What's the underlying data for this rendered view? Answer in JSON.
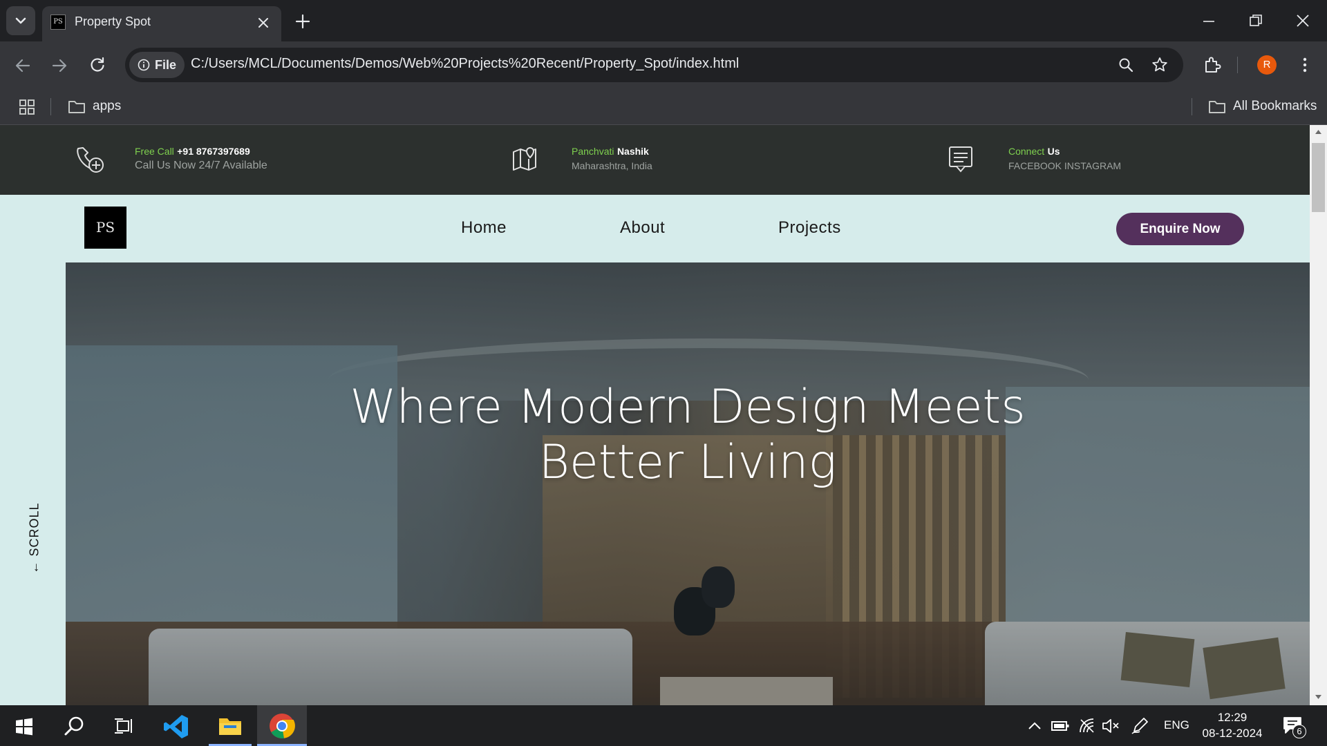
{
  "browser": {
    "tab_title": "Property Spot",
    "url_chip": "File",
    "url": "C:/Users/MCL/Documents/Demos/Web%20Projects%20Recent/Property_Spot/index.html",
    "profile_initial": "R",
    "bookmarks": {
      "apps_folder": "apps",
      "all_bookmarks": "All Bookmarks"
    }
  },
  "site": {
    "contact": {
      "call": {
        "highlight": "Free Call",
        "value": "+91 8767397689",
        "sub": "Call Us Now 24/7 Available"
      },
      "location": {
        "highlight": "Panchvati",
        "value": "Nashik",
        "sub": "Maharashtra, India"
      },
      "connect": {
        "highlight": "Connect",
        "value": "Us",
        "sub": "FACEBOOK INSTAGRAM"
      }
    },
    "logo_text": "PS",
    "nav": {
      "home": "Home",
      "about": "About",
      "projects": "Projects"
    },
    "cta": "Enquire Now",
    "hero_line1": "Where Modern Design Meets",
    "hero_line2": "Better Living",
    "scroll_label": "← SCROLL"
  },
  "taskbar": {
    "language": "ENG",
    "time": "12:29",
    "date": "08-12-2024",
    "notifications": "6"
  },
  "colors": {
    "accent_green": "#7fd14f",
    "cta_purple": "#54305c",
    "nav_bg": "#d6eceb",
    "topbar_bg": "#2c302e"
  }
}
